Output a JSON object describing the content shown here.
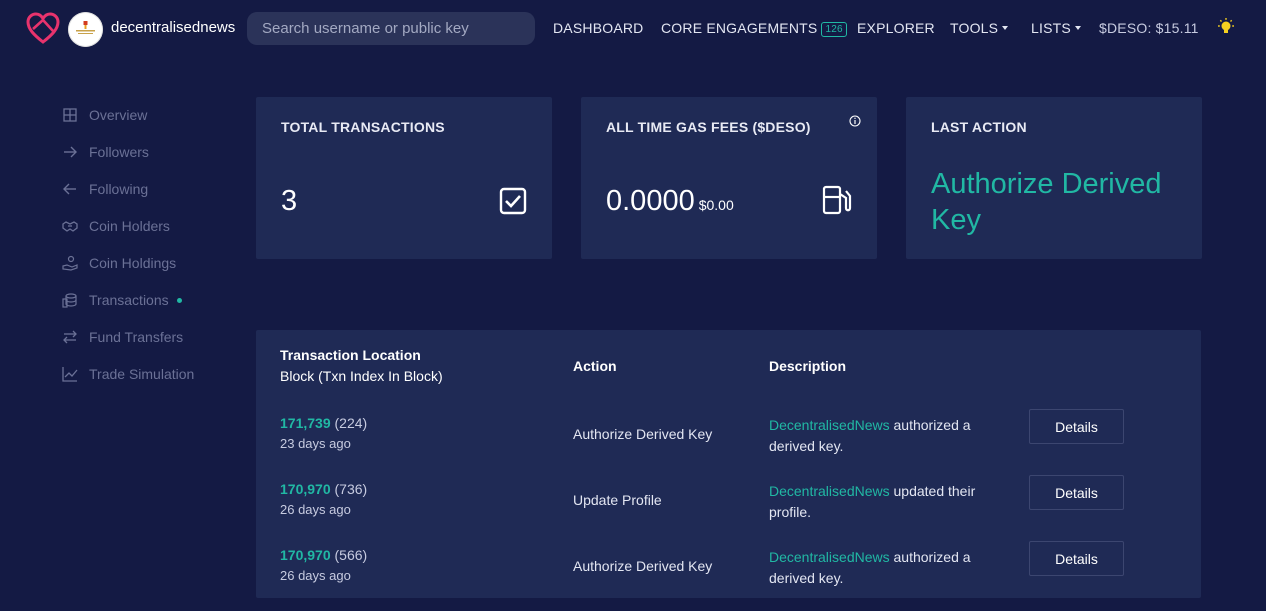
{
  "header": {
    "username": "decentralisednews",
    "search_placeholder": "Search username or public key",
    "nav": {
      "dashboard": "DASHBOARD",
      "core_engagements": "CORE ENGAGEMENTS",
      "core_engagements_count": "126",
      "explorer": "EXPLORER",
      "tools": "TOOLS",
      "lists": "LISTS",
      "balance": "$DESO: $15.11"
    }
  },
  "sidebar": {
    "items": [
      {
        "label": "Overview",
        "icon": "grid-icon"
      },
      {
        "label": "Followers",
        "icon": "arrow-right-icon"
      },
      {
        "label": "Following",
        "icon": "arrow-left-icon"
      },
      {
        "label": "Coin Holders",
        "icon": "handshake-icon"
      },
      {
        "label": "Coin Holdings",
        "icon": "hand-coin-icon"
      },
      {
        "label": "Transactions",
        "icon": "coins-stack-icon",
        "active": true
      },
      {
        "label": "Fund Transfers",
        "icon": "swap-arrows-icon"
      },
      {
        "label": "Trade Simulation",
        "icon": "chart-line-icon"
      }
    ]
  },
  "cards": {
    "total_transactions": {
      "title": "TOTAL TRANSACTIONS",
      "value": "3"
    },
    "gas_fees": {
      "title": "ALL TIME GAS FEES ($DESO)",
      "value": "0.0000",
      "sub": "$0.00"
    },
    "last_action": {
      "title": "LAST ACTION",
      "value": "Authorize Derived Key"
    }
  },
  "table": {
    "headers": {
      "location": "Transaction Location",
      "location_sub": "Block (Txn Index In Block)",
      "action": "Action",
      "description": "Description"
    },
    "rows": [
      {
        "block": "171,739",
        "index": "(224)",
        "ago": "23 days ago",
        "action": "Authorize Derived Key",
        "desc_user": "DecentralisedNews",
        "desc_text": " authorized a derived key.",
        "button": "Details"
      },
      {
        "block": "170,970",
        "index": "(736)",
        "ago": "26 days ago",
        "action": "Update Profile",
        "desc_user": "DecentralisedNews",
        "desc_text": " updated their profile.",
        "button": "Details"
      },
      {
        "block": "170,970",
        "index": "(566)",
        "ago": "26 days ago",
        "action": "Authorize Derived Key",
        "desc_user": "DecentralisedNews",
        "desc_text": " authorized a derived key.",
        "button": "Details"
      }
    ]
  },
  "colors": {
    "background": "#141a44",
    "card": "#1f2a55",
    "accent": "#21b8a4",
    "logo": "#e8336d",
    "bulb": "#f5d020"
  }
}
